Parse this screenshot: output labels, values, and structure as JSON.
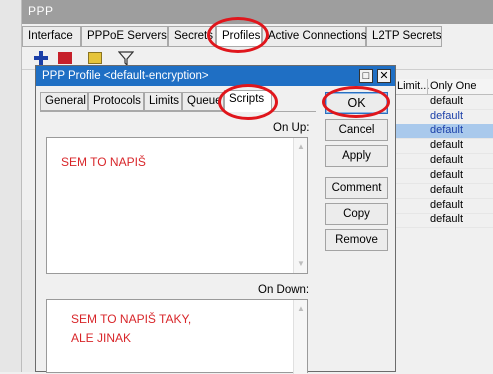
{
  "outer": {
    "title": "PPP",
    "tabs": [
      "Interface",
      "PPPoE Servers",
      "Secrets",
      "Profiles",
      "Active Connections",
      "L2TP Secrets"
    ],
    "columns": [
      "Limit...",
      "Only One"
    ],
    "only_one_values": [
      "default",
      "default",
      "default",
      "default",
      "default",
      "default",
      "default",
      "default",
      "default"
    ]
  },
  "dialog": {
    "title": "PPP Profile <default-encryption>",
    "minimize_glyph": "□",
    "close_glyph": "✕",
    "tabs": [
      "General",
      "Protocols",
      "Limits",
      "Queue",
      "Scripts"
    ],
    "on_up_label": "On Up:",
    "on_down_label": "On Down:",
    "on_up_text": "SEM TO NAPIŠ",
    "on_down_text": "SEM TO NAPIŠ TAKY,\nALE JINAK",
    "buttons": {
      "ok": "OK",
      "cancel": "Cancel",
      "apply": "Apply",
      "comment": "Comment",
      "copy": "Copy",
      "remove": "Remove"
    }
  },
  "colors": {
    "dialog_title_bg": "#1f6fc4",
    "annotation": "#e0161c",
    "script_text": "#d8262a",
    "selected_row": "#a9c9ec"
  }
}
